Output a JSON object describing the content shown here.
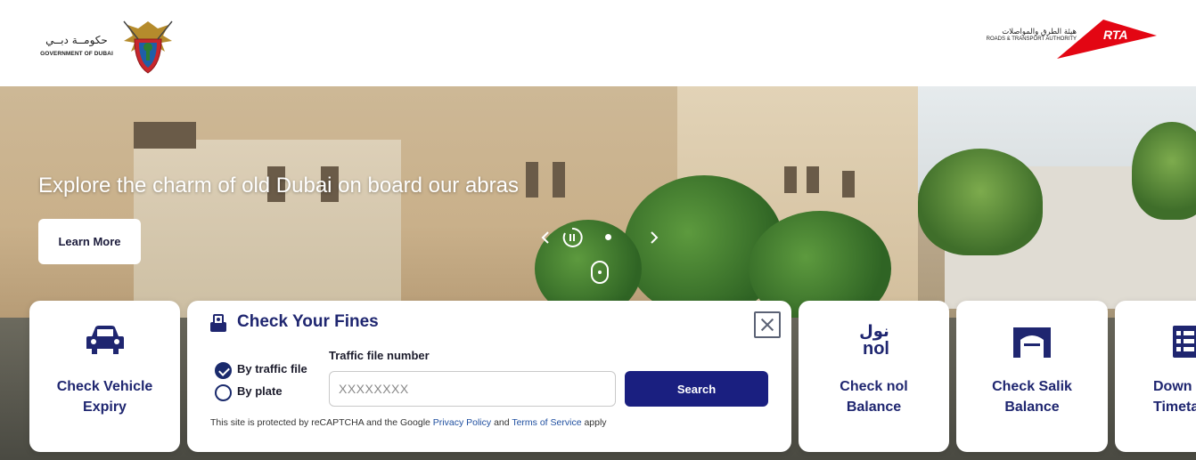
{
  "header": {
    "gov_logo": {
      "arabic": "حكومــة دبــي",
      "english": "GOVERNMENT OF DUBAI"
    },
    "rta_logo": {
      "arabic": "هيئة الطرق والمواصلات",
      "english": "ROADS & TRANSPORT AUTHORITY",
      "mark": "RTA"
    }
  },
  "hero": {
    "title": "Explore the charm of old Dubai on board our abras",
    "cta_label": "Learn More",
    "carousel": {
      "prev_icon": "chevron-left-icon",
      "pause_icon": "pause-icon",
      "next_icon": "chevron-right-icon"
    },
    "scroll_icon": "mouse-scroll-icon"
  },
  "cards": {
    "vehicle_expiry": {
      "label_line1": "Check Vehicle",
      "label_line2": "Expiry",
      "icon": "car-icon"
    },
    "nol": {
      "label_line1": "Check nol",
      "label_line2": "Balance",
      "icon": "nol-icon",
      "icon_text_ar": "نول",
      "icon_text_en": "nol"
    },
    "salik": {
      "label_line1": "Check Salik",
      "label_line2": "Balance",
      "icon": "salik-gate-icon"
    },
    "timetable": {
      "label_line1": "Down",
      "label_line2": "Timeta",
      "icon": "calendar-grid-icon"
    }
  },
  "fines": {
    "title": "Check Your Fines",
    "option_traffic_file": "By traffic file",
    "option_plate": "By plate",
    "selected": "By traffic file",
    "field_label": "Traffic file number",
    "field_placeholder": "XXXXXXXX",
    "search_label": "Search",
    "captcha_prefix": "This site is protected by reCAPTCHA and the Google",
    "privacy_link": "Privacy Policy",
    "and": "and",
    "terms_link": "Terms of Service",
    "apply": "apply"
  },
  "colors": {
    "brand_navy": "#1f2670",
    "button_navy": "#1a1f80",
    "rta_red": "#e30613"
  }
}
